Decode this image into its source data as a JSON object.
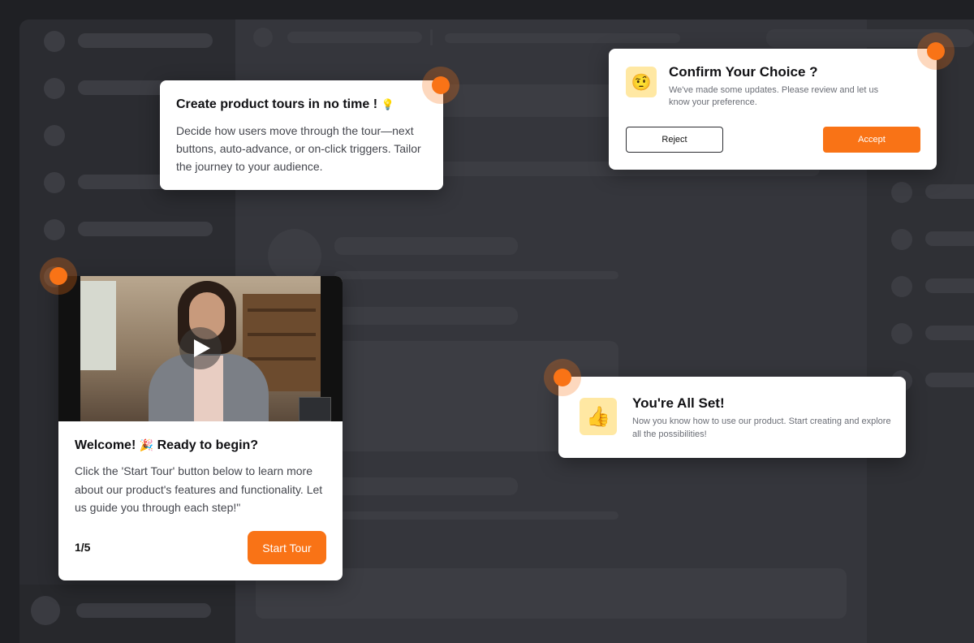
{
  "tours_card": {
    "title": "Create product tours in no time !",
    "title_icon": "💡",
    "body": "Decide how users move through the tour—next buttons, auto-advance, or on-click triggers. Tailor the journey to your audience."
  },
  "confirm_card": {
    "icon": "🤨",
    "title": "Confirm Your Choice ?",
    "body": "We've made some updates. Please review and let us know your preference.",
    "reject_label": "Reject",
    "accept_label": "Accept"
  },
  "allset_card": {
    "icon": "👍",
    "title": "You're All Set!",
    "body": "Now you know how to use our product. Start creating and explore all the possibilities!"
  },
  "welcome_card": {
    "title_start": "Welcome!",
    "title_icon": "🎉",
    "title_end": "Ready to begin?",
    "body": "Click the 'Start Tour' button below to learn more about our product's features and functionality. Let us guide you through each step!\"",
    "step": "1/5",
    "start_label": "Start Tour"
  },
  "colors": {
    "accent": "#f97316",
    "background": "#1f2024",
    "card": "#ffffff"
  }
}
